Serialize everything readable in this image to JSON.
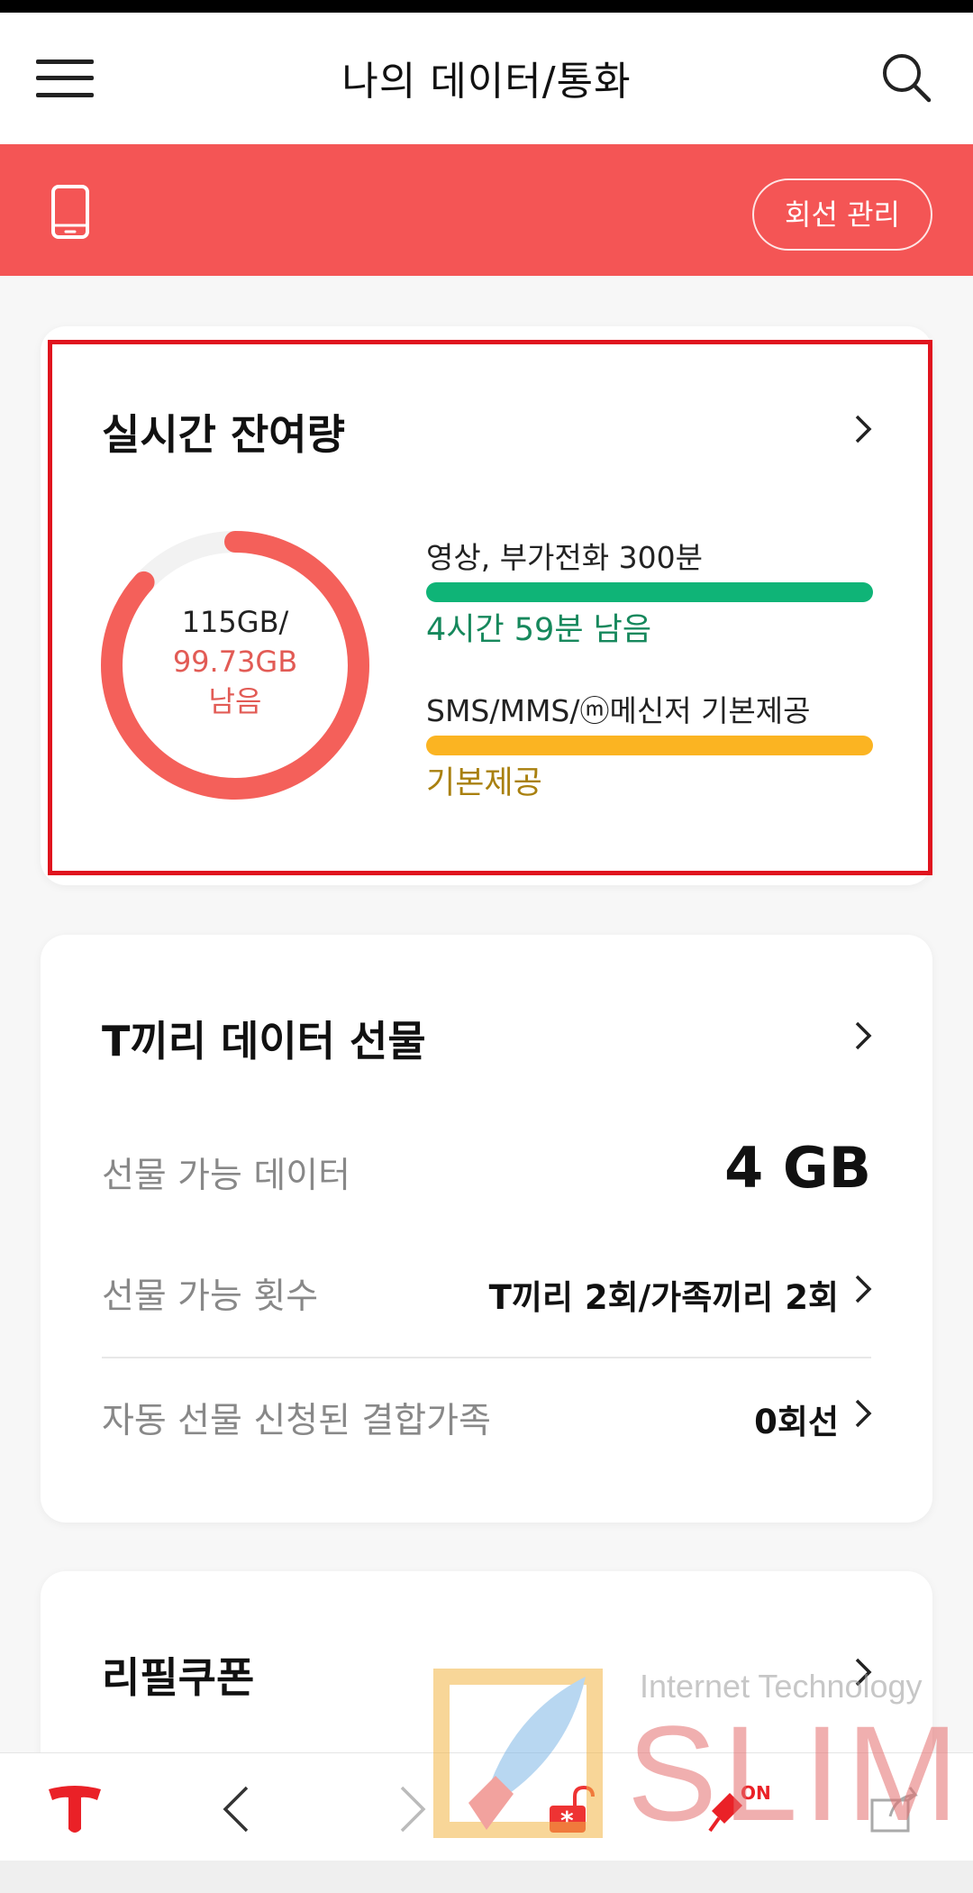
{
  "header": {
    "title": "나의 데이터/통화"
  },
  "line_bar": {
    "manage_label": "회선 관리"
  },
  "remaining_card": {
    "title": "실시간 잔여량",
    "donut": {
      "total": "115GB/",
      "remaining": "99.73GB",
      "remaining_suffix": "남음",
      "fraction_remaining": 0.867,
      "color": "#f4605a"
    },
    "items": [
      {
        "label": "영상, 부가전화 300분",
        "status": "4시간 59분 남음",
        "bar_color": "#0fb477",
        "status_color": "#16885c",
        "fill": 1.0
      },
      {
        "label": "SMS/MMS/ⓜ메신저 기본제공",
        "status": "기본제공",
        "bar_color": "#fbb422",
        "status_color": "#a9800f",
        "fill": 1.0
      }
    ]
  },
  "gift_card": {
    "title": "T끼리 데이터 선물",
    "rows": [
      {
        "label": "선물 가능 데이터",
        "value": "4 GB"
      },
      {
        "label": "선물 가능 횟수",
        "value": "T끼리 2회/가족끼리 2회"
      },
      {
        "label": "자동 선물 신청된 결합가족",
        "value": "0회선"
      }
    ]
  },
  "refill_card": {
    "title": "리필쿠폰"
  },
  "watermark": {
    "subtitle": "Internet Technology",
    "brand": "SLIM"
  },
  "bottom_nav": {
    "lock_badge": "*",
    "pin_badge": "ON"
  },
  "colors": {
    "accent_red": "#f45555",
    "highlight_red": "#e0141e"
  }
}
